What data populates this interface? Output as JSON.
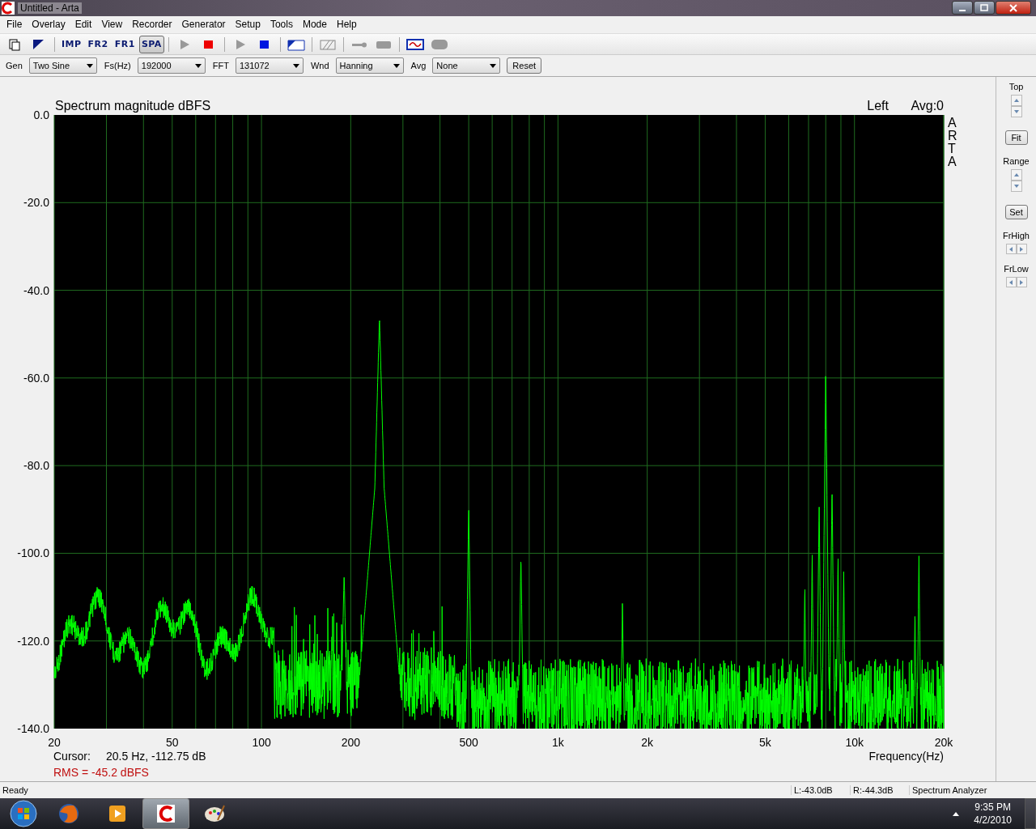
{
  "window": {
    "title": "Untitled - Arta"
  },
  "menu": [
    "File",
    "Overlay",
    "Edit",
    "View",
    "Recorder",
    "Generator",
    "Setup",
    "Tools",
    "Mode",
    "Help"
  ],
  "toolbar": [
    {
      "kind": "new"
    },
    {
      "kind": "mark"
    },
    {
      "kind": "sep"
    },
    {
      "kind": "text",
      "label": "IMP",
      "selected": false
    },
    {
      "kind": "text",
      "label": "FR2",
      "selected": false
    },
    {
      "kind": "text",
      "label": "FR1",
      "selected": false
    },
    {
      "kind": "text",
      "label": "SPA",
      "selected": true
    },
    {
      "kind": "sep"
    },
    {
      "kind": "play-grey"
    },
    {
      "kind": "stop-red"
    },
    {
      "kind": "sep"
    },
    {
      "kind": "play-grey"
    },
    {
      "kind": "stop-blue"
    },
    {
      "kind": "sep"
    },
    {
      "kind": "abc"
    },
    {
      "kind": "sep"
    },
    {
      "kind": "hatch"
    },
    {
      "kind": "sep"
    },
    {
      "kind": "probe"
    },
    {
      "kind": "block"
    },
    {
      "kind": "sep"
    },
    {
      "kind": "scope"
    },
    {
      "kind": "pill"
    }
  ],
  "params": [
    {
      "label": "Gen",
      "value": "Two Sine"
    },
    {
      "label": "Fs(Hz)",
      "value": "192000"
    },
    {
      "label": "FFT",
      "value": "131072"
    },
    {
      "label": "Wnd",
      "value": "Hanning"
    },
    {
      "label": "Avg",
      "value": "None"
    }
  ],
  "reset_button": "Reset",
  "plot": {
    "title": "Spectrum magnitude dBFS",
    "channel": "Left",
    "average": "Avg:0",
    "brand": "ARTA",
    "yticks": [
      "0.0",
      "-20.0",
      "-40.0",
      "-60.0",
      "-80.0",
      "-100.0",
      "-120.0",
      "-140.0"
    ],
    "xticks": [
      "20",
      "50",
      "100",
      "200",
      "500",
      "1k",
      "2k",
      "5k",
      "10k",
      "20k"
    ],
    "xlabel": "Frequency(Hz)",
    "cursor_label": "Cursor:",
    "cursor_value": "20.5 Hz, -112.75 dB",
    "rms": "RMS =  -45.2 dBFS"
  },
  "side_panel": [
    {
      "kind": "vspin",
      "label": "Top"
    },
    {
      "kind": "button",
      "label": "Fit"
    },
    {
      "kind": "vspin",
      "label": "Range"
    },
    {
      "kind": "button",
      "label": "Set"
    },
    {
      "kind": "hspin",
      "label": "FrHigh"
    },
    {
      "kind": "hspin",
      "label": "FrLow"
    }
  ],
  "status_bar": {
    "message": "Ready",
    "left_level": "L:-43.0dB",
    "right_level": "R:-44.3dB",
    "mode": "Spectrum Analyzer"
  },
  "taskbar": {
    "apps": [
      {
        "kind": "browser",
        "selected": false
      },
      {
        "kind": "media",
        "selected": false
      },
      {
        "kind": "arta",
        "selected": true
      },
      {
        "kind": "paint",
        "selected": false
      }
    ],
    "time": "9:35 PM",
    "date": "4/2/2010"
  }
}
